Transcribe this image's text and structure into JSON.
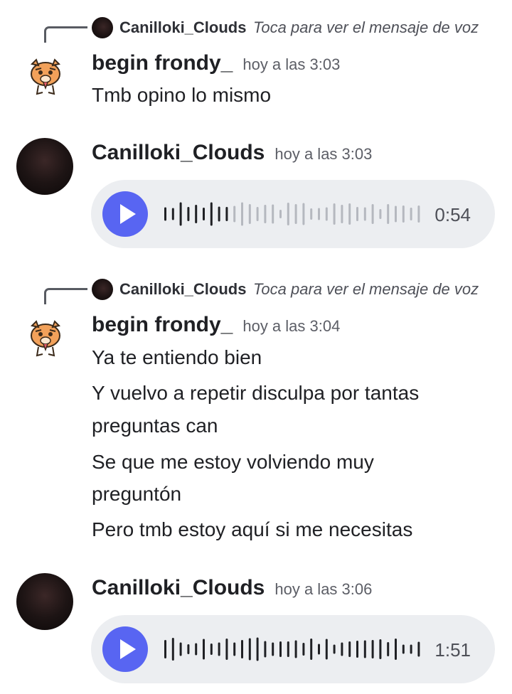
{
  "messages": [
    {
      "reply": {
        "name": "Canilloki_Clouds",
        "text": "Toca para ver el mensaje de voz"
      },
      "author": "begin frondy_",
      "time": "hoy a las 3:03",
      "lines": [
        "Tmb opino lo mismo"
      ]
    },
    {
      "author": "Canilloki_Clouds",
      "time": "hoy a las 3:03",
      "voice": {
        "duration": "0:54",
        "progress": 0.27
      }
    },
    {
      "reply": {
        "name": "Canilloki_Clouds",
        "text": "Toca para ver el mensaje de voz"
      },
      "author": "begin frondy_",
      "time": "hoy a las 3:04",
      "lines": [
        "Ya te entiendo bien",
        "Y vuelvo a repetir disculpa por tantas",
        "preguntas can",
        "Se que me estoy volviendo muy",
        "preguntón",
        "Pero tmb estoy aquí si me necesitas"
      ]
    },
    {
      "author": "Canilloki_Clouds",
      "time": "hoy a las 3:06",
      "voice": {
        "duration": "1:51",
        "progress": 1.0
      }
    }
  ],
  "icons": {
    "play": "play-icon",
    "avatar_tiger": "tiger-sticker-avatar"
  },
  "colors": {
    "accent": "#5865f2",
    "wave_played": "#1f2024",
    "wave_unplayed": "#b5b8bf",
    "bubble": "#eceef1"
  }
}
